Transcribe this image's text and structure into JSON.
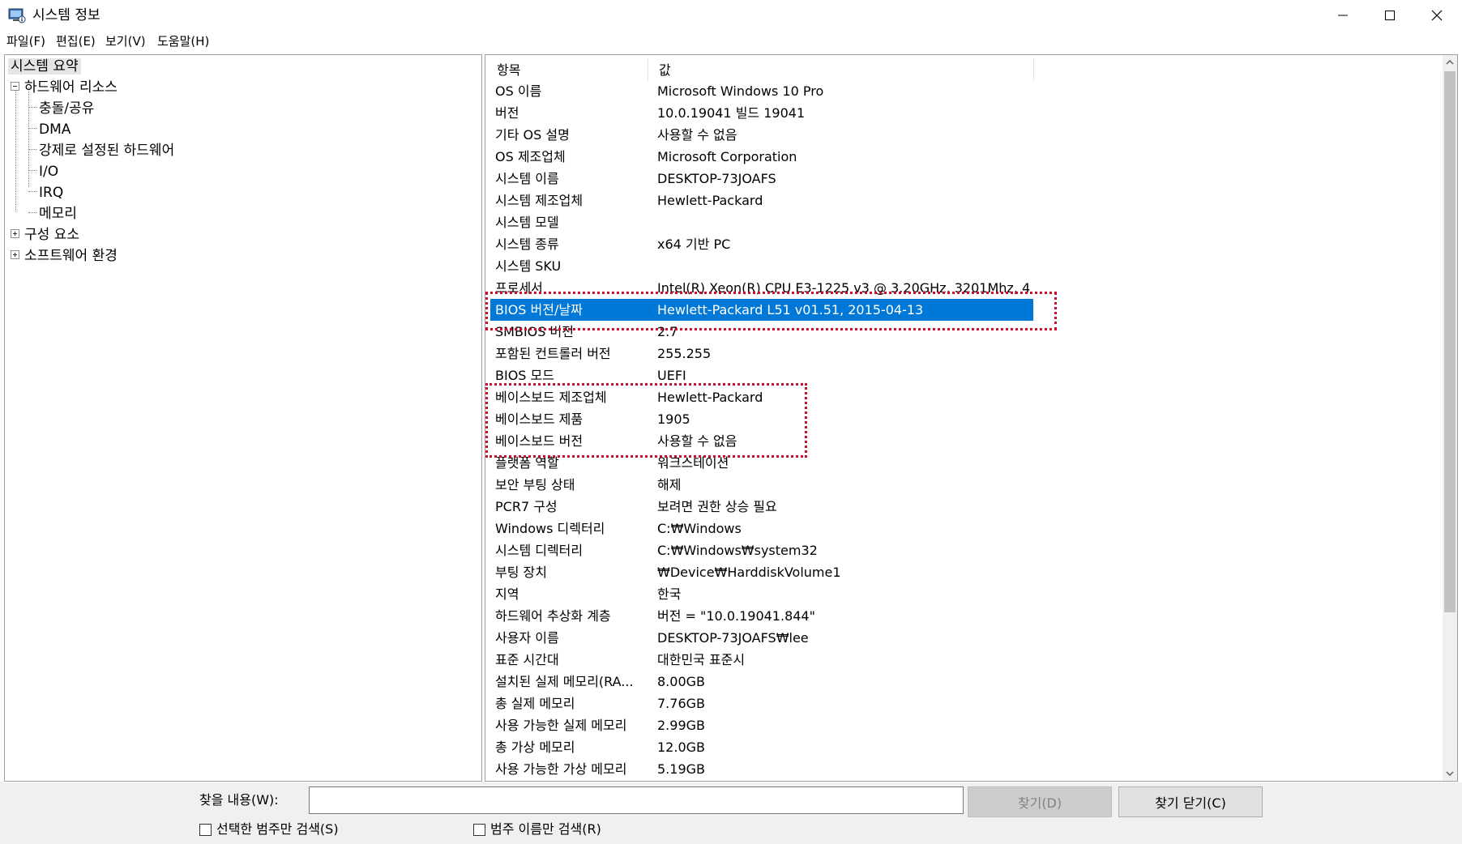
{
  "window": {
    "title": "시스템 정보"
  },
  "menu": [
    "파일(F)",
    "편집(E)",
    "보기(V)",
    "도움말(H)"
  ],
  "tree": {
    "items": [
      {
        "label": "시스템 요약",
        "level": 0,
        "selected": true
      },
      {
        "label": "하드웨어 리소스",
        "level": 0,
        "expander": "minus"
      },
      {
        "label": "충돌/공유",
        "level": 1
      },
      {
        "label": "DMA",
        "level": 1
      },
      {
        "label": "강제로 설정된 하드웨어",
        "level": 1
      },
      {
        "label": "I/O",
        "level": 1
      },
      {
        "label": "IRQ",
        "level": 1
      },
      {
        "label": "메모리",
        "level": 1
      },
      {
        "label": "구성 요소",
        "level": 0,
        "expander": "plus"
      },
      {
        "label": "소프트웨어 환경",
        "level": 0,
        "expander": "plus"
      }
    ]
  },
  "list": {
    "columns": [
      "항목",
      "값"
    ],
    "selected_index": 10,
    "rows": [
      [
        "OS 이름",
        "Microsoft Windows 10 Pro"
      ],
      [
        "버전",
        "10.0.19041 빌드 19041"
      ],
      [
        "기타 OS 설명",
        "사용할 수 없음"
      ],
      [
        "OS 제조업체",
        "Microsoft Corporation"
      ],
      [
        "시스템 이름",
        "DESKTOP-73JOAFS"
      ],
      [
        "시스템 제조업체",
        "Hewlett-Packard"
      ],
      [
        "시스템 모델",
        ""
      ],
      [
        "시스템 종류",
        "x64 기반 PC"
      ],
      [
        "시스템 SKU",
        ""
      ],
      [
        "프로세서",
        "Intel(R) Xeon(R) CPU E3-1225 v3 @ 3.20GHz, 3201Mhz, 4"
      ],
      [
        "BIOS 버전/날짜",
        "Hewlett-Packard L51 v01.51, 2015-04-13"
      ],
      [
        "SMBIOS 버전",
        "2.7"
      ],
      [
        "포함된 컨트롤러 버전",
        "255.255"
      ],
      [
        "BIOS 모드",
        "UEFI"
      ],
      [
        "베이스보드 제조업체",
        "Hewlett-Packard"
      ],
      [
        "베이스보드 제품",
        "1905"
      ],
      [
        "베이스보드 버전",
        "사용할 수 없음"
      ],
      [
        "플랫폼 역할",
        "워크스테이션"
      ],
      [
        "보안 부팅 상태",
        "해제"
      ],
      [
        "PCR7 구성",
        "보려면 권한 상승 필요"
      ],
      [
        "Windows 디렉터리",
        "C:₩Windows"
      ],
      [
        "시스템 디렉터리",
        "C:₩Windows₩system32"
      ],
      [
        "부팅 장치",
        "₩Device₩HarddiskVolume1"
      ],
      [
        "지역",
        "한국"
      ],
      [
        "하드웨어 추상화 계층",
        "버전 = \"10.0.19041.844\""
      ],
      [
        "사용자 이름",
        "DESKTOP-73JOAFS₩lee"
      ],
      [
        "표준 시간대",
        "대한민국 표준시"
      ],
      [
        "설치된 실제 메모리(RA...",
        "8.00GB"
      ],
      [
        "총 실제 메모리",
        "7.76GB"
      ],
      [
        "사용 가능한 실제 메모리",
        "2.99GB"
      ],
      [
        "총 가상 메모리",
        "12.0GB"
      ],
      [
        "사용 가능한 가상 메모리",
        "5.19GB"
      ]
    ]
  },
  "find": {
    "label": "찾을 내용(W):",
    "value": "",
    "find_button": "찾기(D)",
    "close_button": "찾기 닫기(C)",
    "check_selected_category": "선택한 범주만 검색(S)",
    "check_category_names": "범주 이름만 검색(R)"
  },
  "colors": {
    "selection": "#0078d7",
    "annotation": "#c8102e"
  }
}
